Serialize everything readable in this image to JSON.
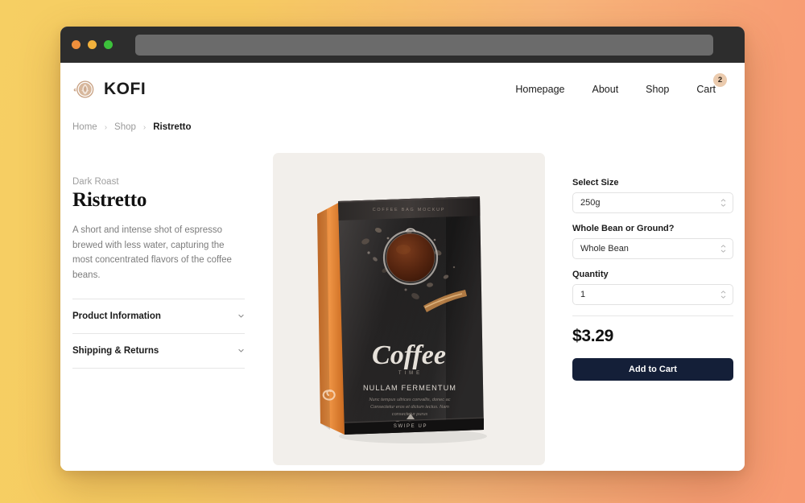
{
  "browser": {
    "traffic_lights": [
      "close-orange",
      "minimize-amber",
      "maximize-green"
    ],
    "address_bar_value": "",
    "address_bar_placeholder": ""
  },
  "header": {
    "brand_name": "KOFI",
    "brand_logo_icon": "coffee-cup-icon",
    "nav": [
      {
        "label": "Homepage"
      },
      {
        "label": "About"
      },
      {
        "label": "Shop"
      },
      {
        "label": "Cart",
        "badge": "2"
      }
    ]
  },
  "breadcrumb": {
    "items": [
      {
        "label": "Home"
      },
      {
        "label": "Shop"
      },
      {
        "label": "Ristretto"
      }
    ],
    "separator": "›"
  },
  "product": {
    "eyebrow": "Dark Roast",
    "title": "Ristretto",
    "description": "A short and intense shot of espresso brewed with less water, capturing the most concentrated flavors of the coffee beans.",
    "accordions": [
      {
        "label": "Product Information",
        "icon": "chevron-down-icon"
      },
      {
        "label": "Shipping & Returns",
        "icon": "chevron-down-icon"
      }
    ],
    "image": {
      "alt": "coffee-bag-product-image",
      "brand_script": "Coffee",
      "brand_sub": "TIME",
      "headline": "NULLAM FERMENTUM",
      "body_line_1": "Nunc tempus ultrices convallis, donec ac",
      "body_line_2": "Consectetur eros et dictum lectus. Nam",
      "body_line_3": "consectetur purus",
      "top_seal_text": "COFFEE BAG MOCKUP",
      "bottom_strip_text": "SWIPE UP",
      "colors": {
        "bag_dark": "#201e1e",
        "gusset_orange": "#e8873a",
        "window_coffee": "#5a2d18",
        "panel_background": "#f2efeb"
      }
    }
  },
  "purchase": {
    "fields": [
      {
        "label": "Select Size",
        "value": "250g",
        "name": "size-select"
      },
      {
        "label": "Whole Bean or Ground?",
        "value": "Whole Bean",
        "name": "grind-select"
      },
      {
        "label": "Quantity",
        "value": "1",
        "name": "quantity-select"
      }
    ],
    "price": "$3.29",
    "add_to_cart_label": "Add to Cart"
  },
  "colors": {
    "background_gradient_start": "#f6cf63",
    "background_gradient_end": "#f79a72",
    "chrome_bar": "#2d2d2d",
    "address_bar": "#6b6b6b",
    "accent_navy": "#141f38",
    "badge_peach": "#ebcbae"
  }
}
